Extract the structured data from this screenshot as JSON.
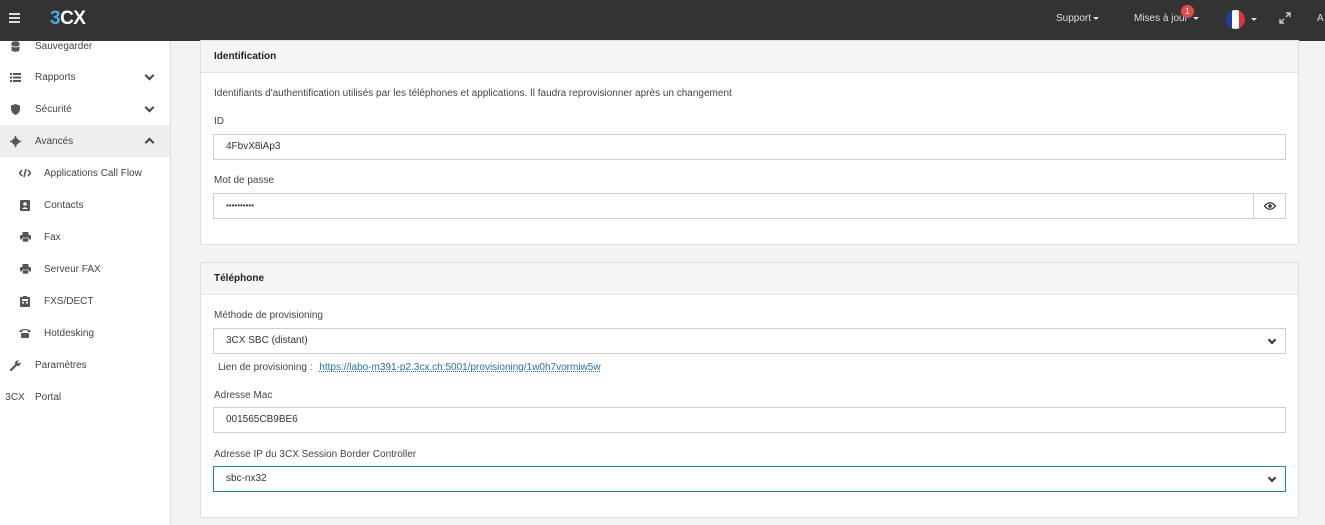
{
  "header": {
    "logo_prefix": "3",
    "logo_suffix": "CX",
    "support_label": "Support",
    "updates_label": "Mises à jour",
    "updates_badge": "1",
    "cut_letter": "A",
    "flag_colors": [
      "#1f3f9a",
      "#ffffff",
      "#e2333a"
    ]
  },
  "sidebar": {
    "items": [
      {
        "label": "Sauvegarder",
        "icon": "database-icon"
      },
      {
        "label": "Rapports",
        "icon": "list-icon"
      },
      {
        "label": "Sécurité",
        "icon": "shield-icon"
      },
      {
        "label": "Avancés",
        "icon": "gear-icon"
      },
      {
        "label": "Applications Call Flow",
        "icon": "code-icon"
      },
      {
        "label": "Contacts",
        "icon": "contact-icon"
      },
      {
        "label": "Fax",
        "icon": "printer-icon"
      },
      {
        "label": "Serveur FAX",
        "icon": "printer-icon"
      },
      {
        "label": "FXS/DECT",
        "icon": "device-icon"
      },
      {
        "label": "Hotdesking",
        "icon": "phone-icon"
      },
      {
        "label": "Paramètres",
        "icon": "wrench-icon"
      },
      {
        "label": "Portal",
        "icon": "3cx-icon"
      }
    ],
    "portal_icon_text": "3CX"
  },
  "identification": {
    "title": "Identification",
    "description": "Identifiants d'authentification utilisés par les téléphones et applications. Il faudra reprovisionner après un changement",
    "id_label": "ID",
    "id_value": "4FbvX8iAp3",
    "password_label": "Mot de passe",
    "password_value": "••••••••••"
  },
  "telephone": {
    "title": "Téléphone",
    "method_label": "Méthode de provisioning",
    "method_value": "3CX SBC (distant)",
    "link_label": "Lien de provisioning :",
    "link_value": "https://labo-m391-p2.3cx.ch:5001/provisioning/1w0h7vormiw5w",
    "mac_label": "Adresse Mac",
    "mac_value": "001565CB9BE6",
    "sbc_label": "Adresse IP du 3CX Session Border Controller",
    "sbc_value": "sbc-nx32"
  },
  "colors": {
    "topbar": "#333333",
    "focus_border": "#1a8a8a",
    "link": "#2a6fa8",
    "badge": "#e24b4b"
  }
}
